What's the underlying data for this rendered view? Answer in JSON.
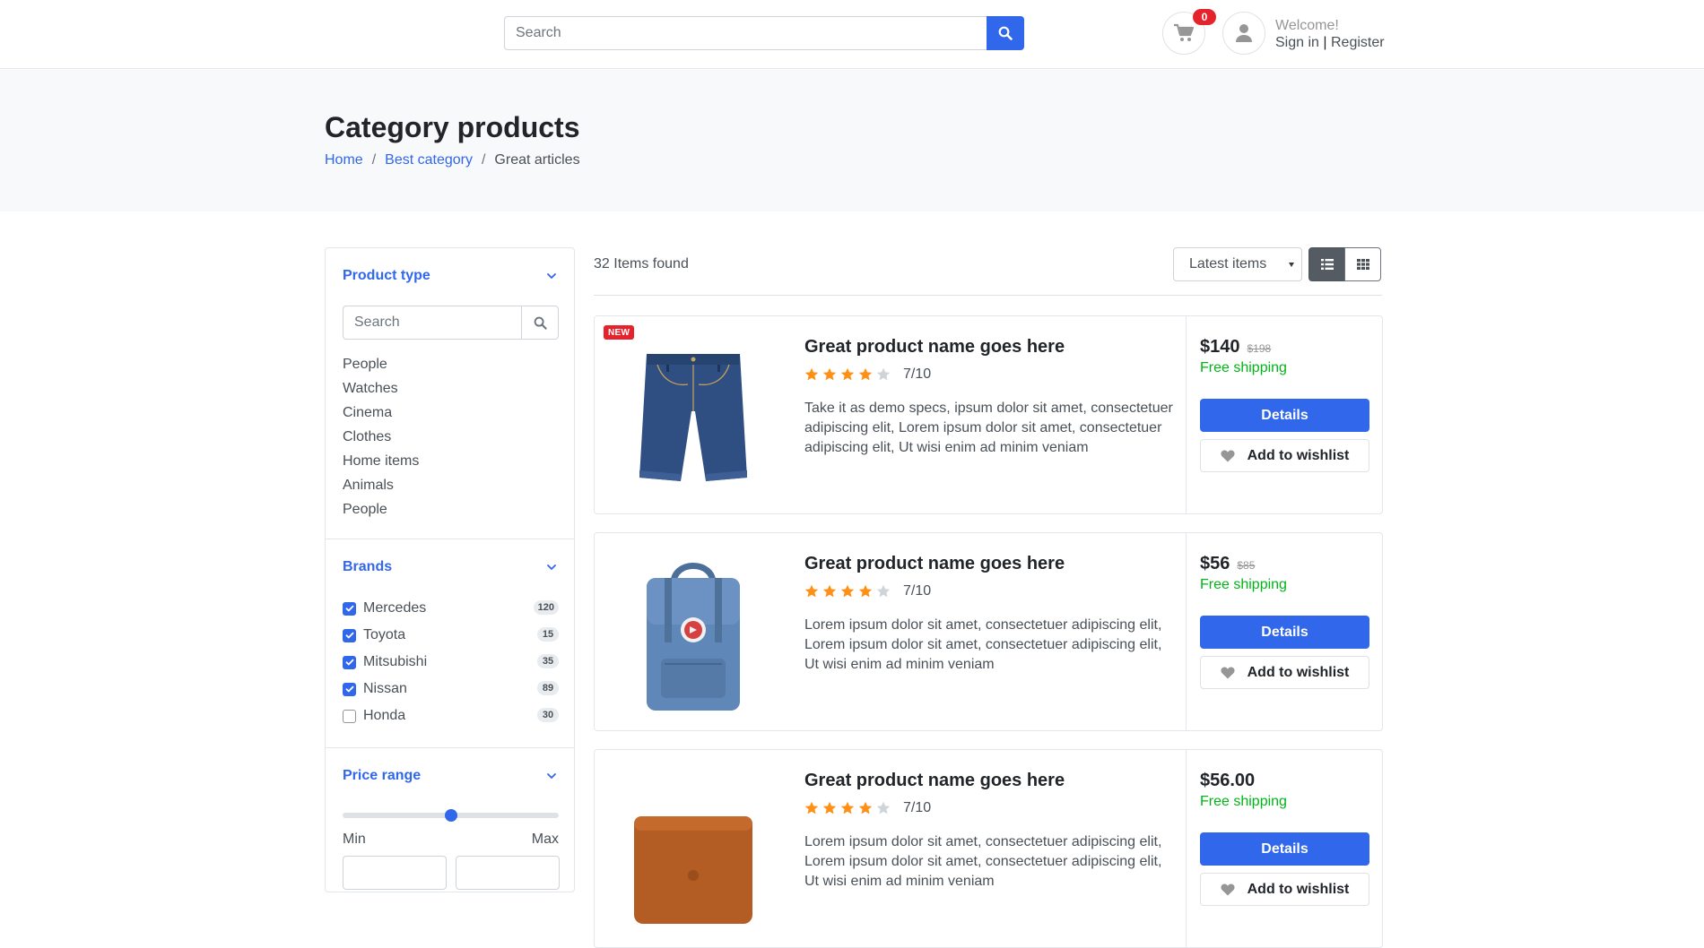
{
  "header": {
    "search_placeholder": "Search",
    "cart_count": "0",
    "welcome": "Welcome!",
    "sign_in": "Sign in",
    "separator": "|",
    "register": "Register"
  },
  "banner": {
    "title": "Category products",
    "breadcrumb": [
      "Home",
      "Best category",
      "Great articles"
    ]
  },
  "sidebar": {
    "product_type": {
      "heading": "Product type",
      "search_placeholder": "Search",
      "items": [
        "People",
        "Watches",
        "Cinema",
        "Clothes",
        "Home items",
        "Animals",
        "People"
      ]
    },
    "brands": {
      "heading": "Brands",
      "items": [
        {
          "name": "Mercedes",
          "count": "120",
          "checked": true
        },
        {
          "name": "Toyota",
          "count": "15",
          "checked": true
        },
        {
          "name": "Mitsubishi",
          "count": "35",
          "checked": true
        },
        {
          "name": "Nissan",
          "count": "89",
          "checked": true
        },
        {
          "name": "Honda",
          "count": "30",
          "checked": false
        }
      ]
    },
    "price_range": {
      "heading": "Price range",
      "slider_value_fraction": 0.5,
      "min_label": "Min",
      "max_label": "Max"
    }
  },
  "main": {
    "items_found": "32 Items found",
    "sort_selected": "Latest items",
    "products": [
      {
        "name": "Great product name goes here",
        "badge": "NEW",
        "rating": "7/10",
        "stars": 4,
        "description": "Take it as demo specs, ipsum dolor sit amet, consectetuer adipiscing elit, Lorem ipsum dolor sit amet, consectetuer adipiscing elit, Ut wisi enim ad minim veniam",
        "price": "$140",
        "old_price": "$198",
        "shipping": "Free shipping",
        "details_label": "Details",
        "wishlist_label": "Add to wishlist",
        "image": "denim-shorts"
      },
      {
        "name": "Great product name goes here",
        "badge": "",
        "rating": "7/10",
        "stars": 4,
        "description": "Lorem ipsum dolor sit amet, consectetuer adipiscing elit, Lorem ipsum dolor sit amet, consectetuer adipiscing elit, Ut wisi enim ad minim veniam",
        "price": "$56",
        "old_price": "$85",
        "shipping": "Free shipping",
        "details_label": "Details",
        "wishlist_label": "Add to wishlist",
        "image": "blue-backpack"
      },
      {
        "name": "Great product name goes here",
        "badge": "",
        "rating": "7/10",
        "stars": 4,
        "description": "Lorem ipsum dolor sit amet, consectetuer adipiscing elit, Lorem ipsum dolor sit amet, consectetuer adipiscing elit, Ut wisi enim ad minim veniam",
        "price": "$56.00",
        "old_price": "",
        "shipping": "Free shipping",
        "details_label": "Details",
        "wishlist_label": "Add to wishlist",
        "image": "leather-sleeve"
      }
    ]
  },
  "colors": {
    "primary": "#3167eb",
    "danger": "#e4232c",
    "success": "#00b517",
    "star": "#ff9017",
    "star_empty": "#cfd4d9"
  }
}
